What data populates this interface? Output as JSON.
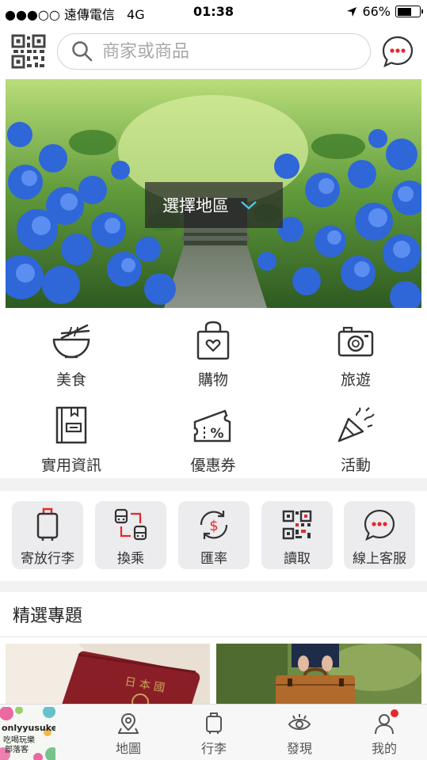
{
  "status_bar": {
    "signal": "●●●○○",
    "carrier": "遠傳電信",
    "network": "4G",
    "time": "01:38",
    "battery": "66%",
    "battery_level": 0.66
  },
  "header": {
    "search_placeholder": "商家或商品"
  },
  "banner": {
    "region_label": "選擇地區"
  },
  "categories": [
    {
      "label": "美食",
      "icon": "noodle-bowl-icon"
    },
    {
      "label": "購物",
      "icon": "shopping-bag-icon"
    },
    {
      "label": "旅遊",
      "icon": "camera-icon"
    },
    {
      "label": "實用資訊",
      "icon": "book-icon"
    },
    {
      "label": "優惠券",
      "icon": "coupon-icon"
    },
    {
      "label": "活動",
      "icon": "party-popper-icon"
    }
  ],
  "tools": [
    {
      "label": "寄放行李",
      "icon": "luggage-icon"
    },
    {
      "label": "換乘",
      "icon": "transfer-icon"
    },
    {
      "label": "匯率",
      "icon": "exchange-rate-icon"
    },
    {
      "label": "讀取",
      "icon": "qr-code-icon"
    },
    {
      "label": "線上客服",
      "icon": "chat-icon"
    }
  ],
  "featured": {
    "title": "精選專題"
  },
  "promo": {
    "line1": "onlyyusuke",
    "line2": "吃喝玩樂",
    "line3": "部落客"
  },
  "tabs": [
    {
      "label": "地圖",
      "icon": "map-pin-icon"
    },
    {
      "label": "行李",
      "icon": "luggage-icon"
    },
    {
      "label": "發現",
      "icon": "eye-icon"
    },
    {
      "label": "我的",
      "icon": "user-icon"
    }
  ],
  "colors": {
    "accent": "#e8262b",
    "tool_bg": "#ececef",
    "divider": "#f2f2f2"
  }
}
